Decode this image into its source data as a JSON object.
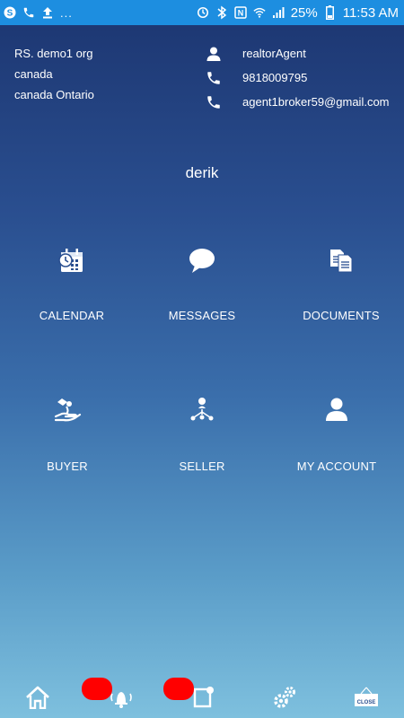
{
  "status_bar": {
    "battery": "25%",
    "time": "11:53 AM",
    "dots": "..."
  },
  "org": {
    "name": "RS. demo1 org",
    "country": "canada",
    "region": "canada Ontario"
  },
  "contact": {
    "role": "realtorAgent",
    "phone": "9818009795",
    "email": "agent1broker59@gmail.com"
  },
  "user": {
    "name": "derik"
  },
  "menu": {
    "calendar": "CALENDAR",
    "messages": "MESSAGES",
    "documents": "DOCUMENTS",
    "buyer": "BUYER",
    "seller": "SELLER",
    "my_account": "MY ACCOUNT"
  },
  "bottom_nav": {
    "close_label": "CLOSE"
  },
  "colors": {
    "status_bar": "#1d8ee0",
    "badge": "#ff0000"
  }
}
